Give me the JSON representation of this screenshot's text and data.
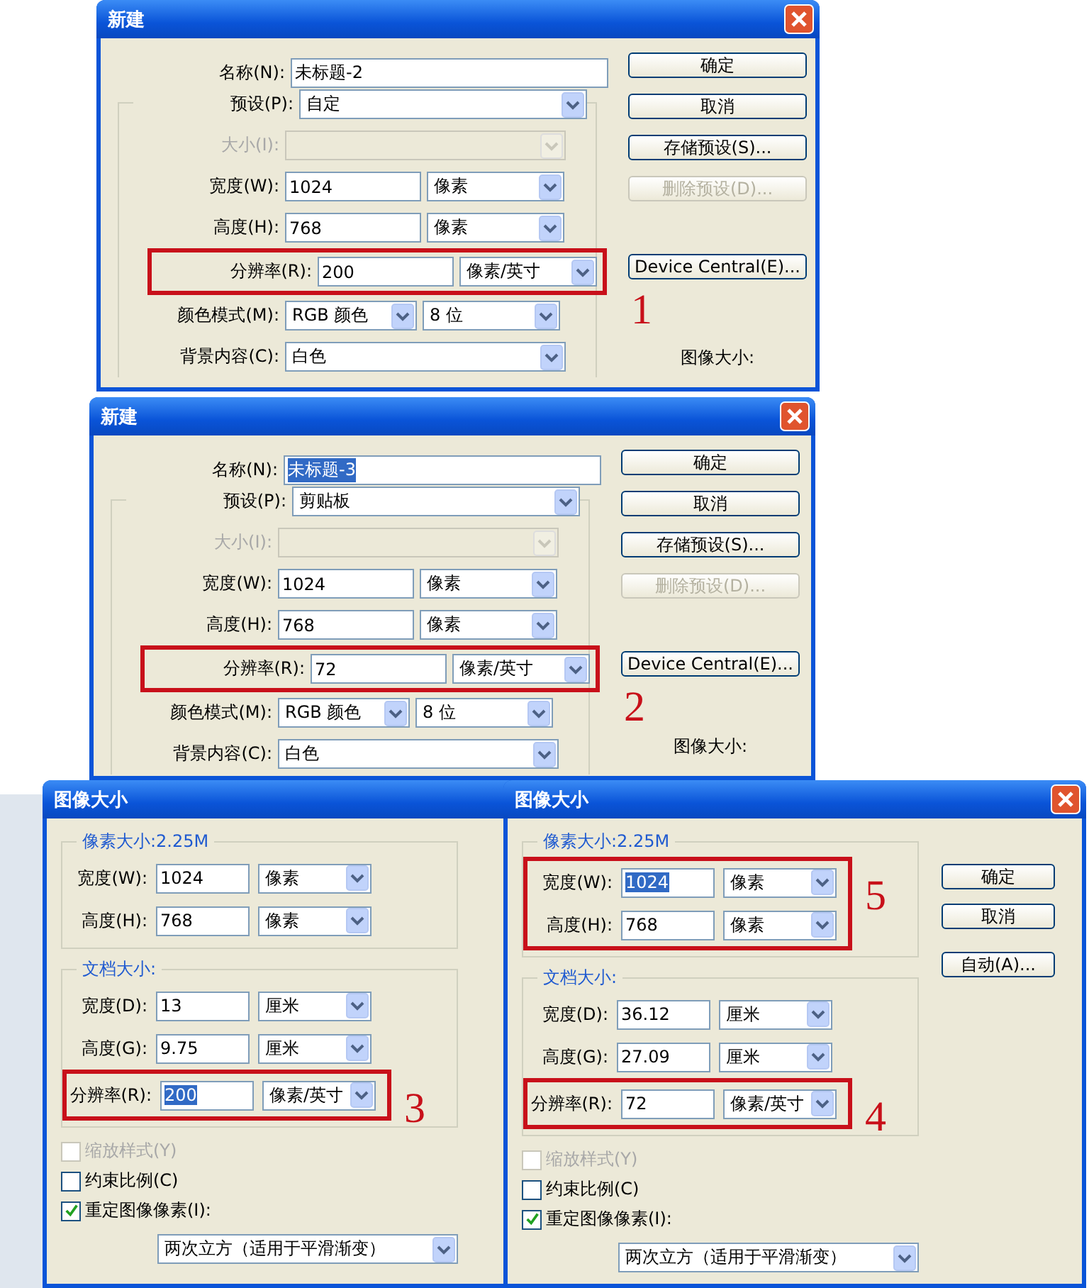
{
  "dialogs": [
    {
      "kind": "new-document",
      "title": "新建",
      "close": true,
      "annotation_number": "1",
      "rows": [
        {
          "kind": "text",
          "label": "名称(N):",
          "value": "未标题-2",
          "selected": false
        },
        {
          "kind": "select",
          "label": "预设(P):",
          "value": "自定"
        },
        {
          "kind": "select",
          "label": "大小(I):",
          "disabled": true
        },
        {
          "kind": "input-unit",
          "label": "宽度(W):",
          "value": "1024",
          "unit": "像素",
          "selected": false
        },
        {
          "kind": "input-unit",
          "label": "高度(H):",
          "value": "768",
          "unit": "像素",
          "selected": false
        },
        {
          "kind": "input-unit",
          "label": "分辨率(R):",
          "value": "200",
          "unit": "像素/英寸",
          "selected": false,
          "marked": true
        },
        {
          "kind": "two-selects",
          "label": "颜色模式(M):",
          "value": "RGB 颜色",
          "unit": "8 位"
        },
        {
          "kind": "select",
          "label": "背景内容(C):",
          "value": "白色"
        }
      ],
      "buttons": [
        {
          "label": "确定"
        },
        {
          "label": "取消"
        },
        {
          "label": "存储预设(S)..."
        },
        {
          "label": "删除预设(D)...",
          "disabled": true
        },
        {
          "label": "Device Central(E)..."
        }
      ],
      "info_label": "图像大小:"
    },
    {
      "kind": "new-document",
      "title": "新建",
      "close": true,
      "annotation_number": "2",
      "rows": [
        {
          "kind": "text",
          "label": "名称(N):",
          "value": "未标题-3",
          "selected": true
        },
        {
          "kind": "select",
          "label": "预设(P):",
          "value": "剪贴板"
        },
        {
          "kind": "select",
          "label": "大小(I):",
          "disabled": true
        },
        {
          "kind": "input-unit",
          "label": "宽度(W):",
          "value": "1024",
          "unit": "像素",
          "selected": false
        },
        {
          "kind": "input-unit",
          "label": "高度(H):",
          "value": "768",
          "unit": "像素",
          "selected": false
        },
        {
          "kind": "input-unit",
          "label": "分辨率(R):",
          "value": "72",
          "unit": "像素/英寸",
          "selected": false,
          "marked": true
        },
        {
          "kind": "two-selects",
          "label": "颜色模式(M):",
          "value": "RGB 颜色",
          "unit": "8 位"
        },
        {
          "kind": "select",
          "label": "背景内容(C):",
          "value": "白色"
        }
      ],
      "buttons": [
        {
          "label": "确定"
        },
        {
          "label": "取消"
        },
        {
          "label": "存储预设(S)..."
        },
        {
          "label": "删除预设(D)...",
          "disabled": true
        },
        {
          "label": "Device Central(E)..."
        }
      ],
      "info_label": "图像大小:"
    },
    {
      "kind": "image-size",
      "title": "图像大小",
      "annotation_number": "3",
      "sections": [
        {
          "title": "像素大小:2.25M",
          "rows": [
            {
              "kind": "input-unit",
              "label": "宽度(W):",
              "value": "1024",
              "unit": "像素",
              "selected": false
            },
            {
              "kind": "input-unit",
              "label": "高度(H):",
              "value": "768",
              "unit": "像素",
              "selected": false
            }
          ]
        },
        {
          "title": "文档大小:",
          "rows": [
            {
              "kind": "input-unit",
              "label": "宽度(D):",
              "value": "13",
              "unit": "厘米",
              "selected": false
            },
            {
              "kind": "input-unit",
              "label": "高度(G):",
              "value": "9.75",
              "unit": "厘米",
              "selected": false
            },
            {
              "kind": "input-unit",
              "label": "分辨率(R):",
              "value": "200",
              "unit": "像素/英寸",
              "selected": true,
              "marked": true
            }
          ]
        }
      ],
      "checkboxes": [
        {
          "label": "缩放样式(Y)",
          "checked": false,
          "disabled": true
        },
        {
          "label": "约束比例(C)",
          "checked": false,
          "disabled": false
        },
        {
          "label": "重定图像像素(I):",
          "checked": true,
          "disabled": false
        }
      ],
      "resample": "两次立方（适用于平滑渐变）"
    },
    {
      "kind": "image-size",
      "title": "图像大小",
      "close": true,
      "annotation_number": "4",
      "sections": [
        {
          "title": "像素大小:2.25M",
          "annotation_number": "5",
          "rows": [
            {
              "kind": "input-unit",
              "label": "宽度(W):",
              "value": "1024",
              "unit": "像素",
              "selected": true,
              "marked": true
            },
            {
              "kind": "input-unit",
              "label": "高度(H):",
              "value": "768",
              "unit": "像素",
              "selected": false,
              "marked": true
            }
          ]
        },
        {
          "title": "文档大小:",
          "rows": [
            {
              "kind": "input-unit",
              "label": "宽度(D):",
              "value": "36.12",
              "unit": "厘米",
              "selected": false
            },
            {
              "kind": "input-unit",
              "label": "高度(G):",
              "value": "27.09",
              "unit": "厘米",
              "selected": false
            },
            {
              "kind": "input-unit",
              "label": "分辨率(R):",
              "value": "72",
              "unit": "像素/英寸",
              "selected": false,
              "marked": true
            }
          ]
        }
      ],
      "checkboxes": [
        {
          "label": "缩放样式(Y)",
          "checked": false,
          "disabled": true
        },
        {
          "label": "约束比例(C)",
          "checked": false,
          "disabled": false
        },
        {
          "label": "重定图像像素(I):",
          "checked": true,
          "disabled": false
        }
      ],
      "resample": "两次立方（适用于平滑渐变）",
      "buttons": [
        {
          "label": "确定"
        },
        {
          "label": "取消"
        },
        {
          "label": "自动(A)..."
        }
      ]
    }
  ]
}
